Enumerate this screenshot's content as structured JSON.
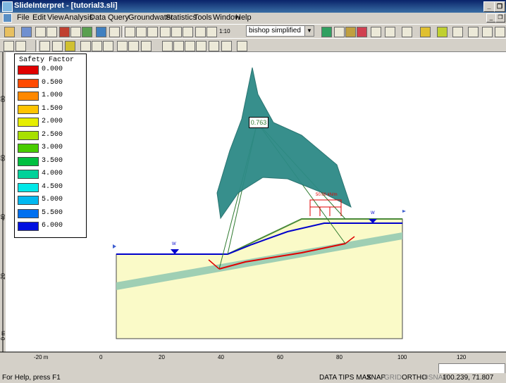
{
  "window": {
    "title": "SlideInterpret - [tutorial3.sli]"
  },
  "menu": [
    "File",
    "Edit",
    "View",
    "Analysis",
    "Data",
    "Query",
    "Groundwater",
    "Statistics",
    "Tools",
    "Window",
    "Help"
  ],
  "toolbar": {
    "method_select": "bishop simplified",
    "zoom_label": "1:10"
  },
  "legend": {
    "title": "Safety Factor",
    "items": [
      {
        "value": "0.000",
        "color": "#e00000"
      },
      {
        "value": "0.500",
        "color": "#ff4a00"
      },
      {
        "value": "1.000",
        "color": "#ff8800"
      },
      {
        "value": "1.500",
        "color": "#ffc400"
      },
      {
        "value": "2.000",
        "color": "#e6ee00"
      },
      {
        "value": "2.500",
        "color": "#a8e000"
      },
      {
        "value": "3.000",
        "color": "#48cc00"
      },
      {
        "value": "3.500",
        "color": "#00c040"
      },
      {
        "value": "4.000",
        "color": "#00d29a"
      },
      {
        "value": "4.500",
        "color": "#00e8e8"
      },
      {
        "value": "5.000",
        "color": "#00b8f0"
      },
      {
        "value": "5.500",
        "color": "#0070f0"
      },
      {
        "value": "6.000",
        "color": "#0010e0"
      }
    ]
  },
  "model": {
    "factor_of_safety": "0.763",
    "load_label": "50.00 kN/m",
    "water_symbol": "W"
  },
  "ruler": {
    "x_ticks": [
      "-20 m",
      "0",
      "20",
      "40",
      "60",
      "80",
      "100",
      "120"
    ],
    "y_ticks": [
      "80",
      "60",
      "40",
      "20",
      "0 m"
    ]
  },
  "status": {
    "help": "For Help, press F1",
    "data_tips": "DATA TIPS MAX",
    "snap": "SNAP",
    "grid": "GRID",
    "ortho": "ORTHO",
    "osnap": "OSNAP",
    "coords": "100.239, 71.807"
  },
  "colors": {
    "slope_fill": "#fafac8",
    "water_line": "#0000cc",
    "slip_circle": "#2d8a86",
    "weak_layer": "#9fcfb4",
    "surface_line": "#4a8a3a"
  }
}
